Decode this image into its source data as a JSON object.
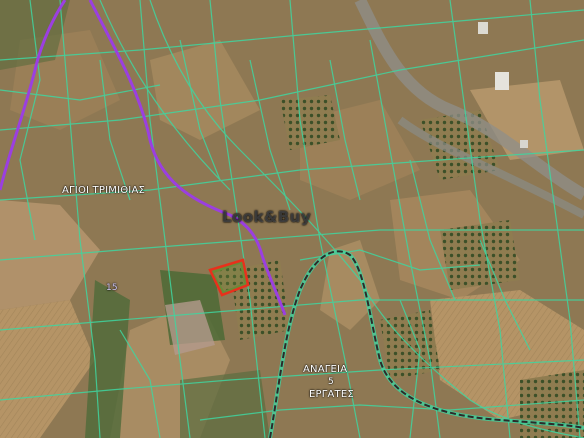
{
  "map": {
    "labels": {
      "village_1": "ΑΓΙΟΙ ΤΡΙΜΙΘΙΑΣ",
      "village_2": "ΑΝΑΓΕΙΑ",
      "village_2_number": "5",
      "village_3": "ΕΡΓΑΤΕΣ",
      "route_number": "15"
    },
    "watermark": "Look&Buy",
    "colors": {
      "parcel_lines": "#3fd6a0",
      "district_boundary": "#9b3fe0",
      "road": "#2a2a2a",
      "highlighted_parcel": "#e8301c",
      "farmland": "#a88a5c",
      "vegetation": "#4d6a35"
    }
  }
}
